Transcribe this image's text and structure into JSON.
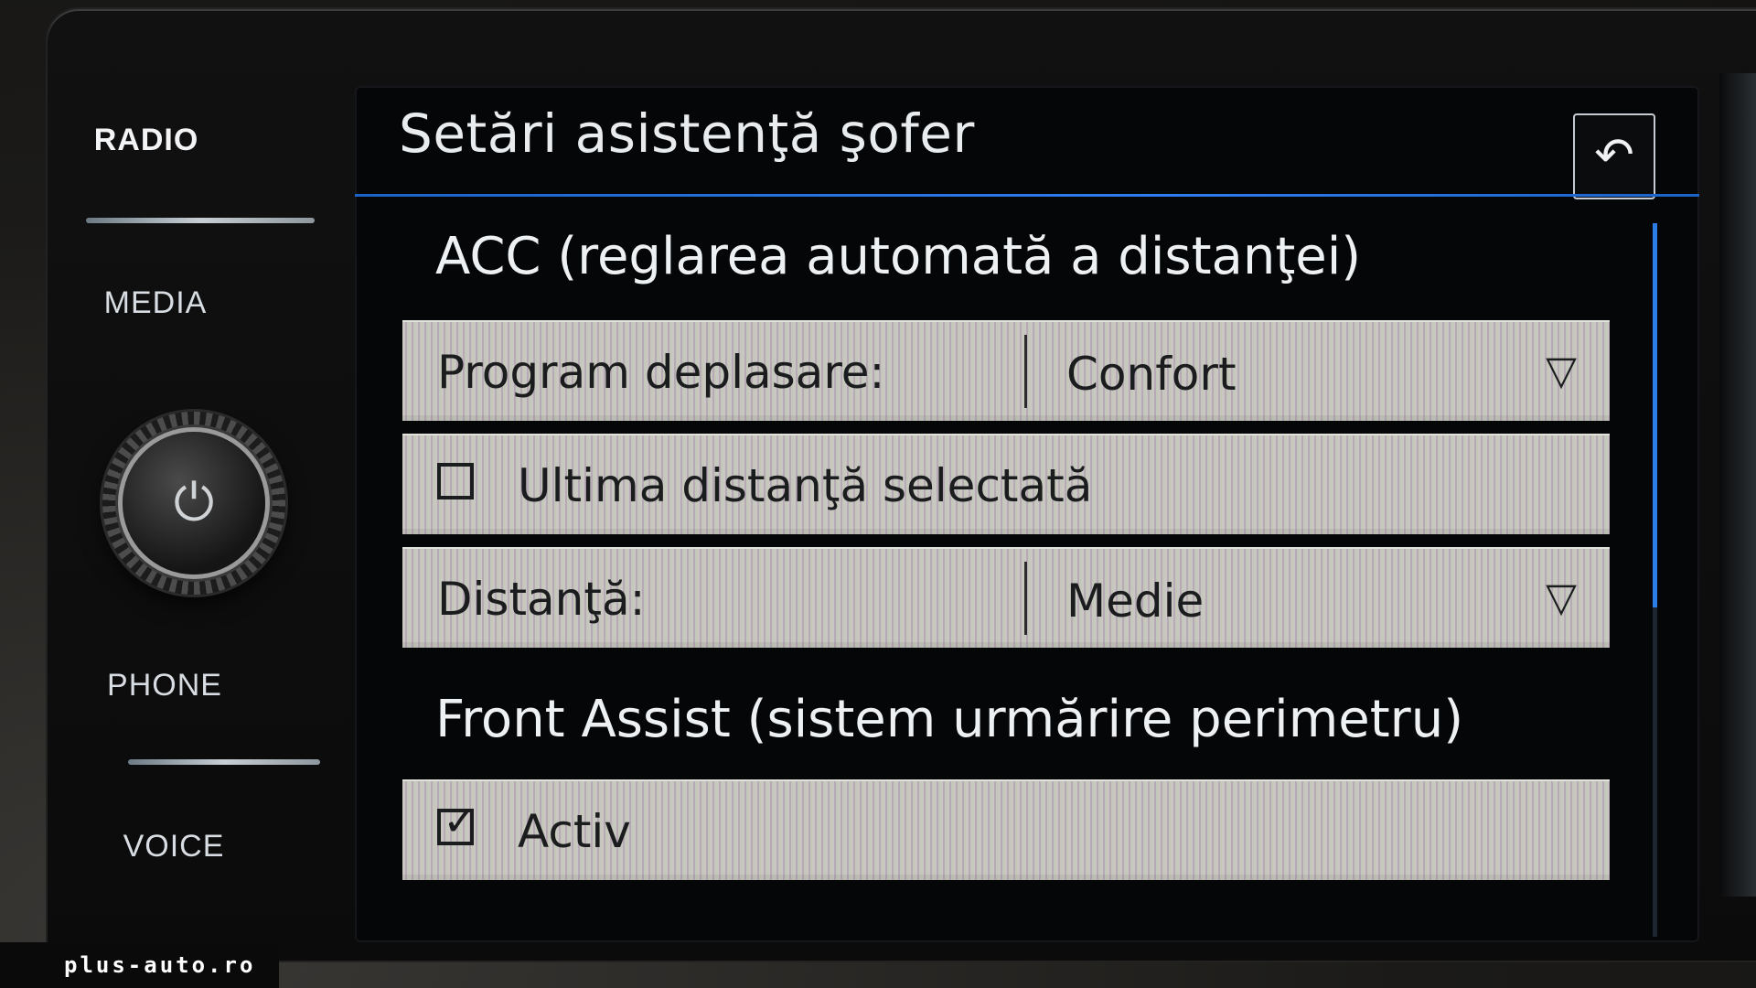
{
  "sidebar": {
    "radio": "RADIO",
    "media": "MEDIA",
    "phone": "PHONE",
    "voice": "VOICE",
    "knob_symbol": "⏻"
  },
  "header": {
    "title": "Setări asistenţă şofer",
    "back_symbol": "↶"
  },
  "sections": {
    "acc": {
      "heading": "ACC (reglarea automată a distanţei)",
      "program_label": "Program deplasare:",
      "program_value": "Confort",
      "last_distance_label": "Ultima distanţă selectată",
      "last_distance_checked": false,
      "distance_label": "Distanţă:",
      "distance_value": "Medie",
      "dropdown_symbol": "▽"
    },
    "front_assist": {
      "heading": "Front Assist (sistem urmărire perimetru)",
      "active_label": "Activ",
      "active_checked": true,
      "check_symbol": "✓"
    }
  },
  "watermark": "plus-auto.ro",
  "colors": {
    "accent": "#2f7cf0",
    "row_background": "#c9c7c1",
    "screen_background": "#050607"
  }
}
